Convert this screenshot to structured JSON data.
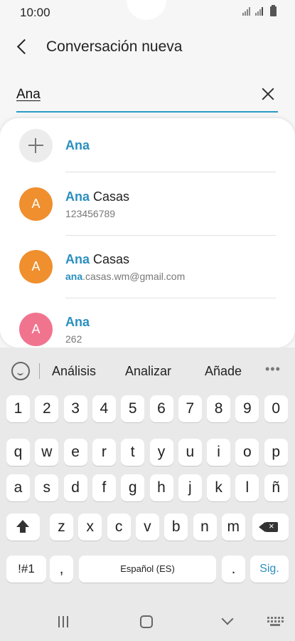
{
  "status_bar": {
    "time": "10:00"
  },
  "header": {
    "title": "Conversación nueva"
  },
  "search": {
    "value": "Ana"
  },
  "results": {
    "add_item": {
      "label": "Ana"
    },
    "contacts": [
      {
        "initial": "A",
        "highlight": "Ana",
        "rest": " Casas",
        "sub_highlight": "",
        "sub_rest": "123456789",
        "color": "#ef8f2e"
      },
      {
        "initial": "A",
        "highlight": "Ana",
        "rest": " Casas",
        "sub_highlight": "ana",
        "sub_rest": ".casas.wm@gmail.com",
        "color": "#ef8f2e"
      },
      {
        "initial": "A",
        "highlight": "Ana",
        "rest": "",
        "sub_highlight": "",
        "sub_rest": "262",
        "color": "#f1748f"
      }
    ]
  },
  "keyboard": {
    "suggestions": [
      "Análisis",
      "Analizar",
      "Añade"
    ],
    "more_icon": "more-dots-icon",
    "row_numbers": [
      "1",
      "2",
      "3",
      "4",
      "5",
      "6",
      "7",
      "8",
      "9",
      "0"
    ],
    "row_1": [
      "q",
      "w",
      "e",
      "r",
      "t",
      "y",
      "u",
      "i",
      "o",
      "p"
    ],
    "row_2": [
      "a",
      "s",
      "d",
      "f",
      "g",
      "h",
      "j",
      "k",
      "l",
      "ñ"
    ],
    "row_3": [
      "z",
      "x",
      "c",
      "v",
      "b",
      "n",
      "m"
    ],
    "symbols_key": "!#1",
    "comma_key": ",",
    "space_key": "Español (ES)",
    "period_key": ".",
    "next_key": "Sig."
  },
  "colors": {
    "accent": "#2a8fc0",
    "underline": "#2a9bc4"
  }
}
